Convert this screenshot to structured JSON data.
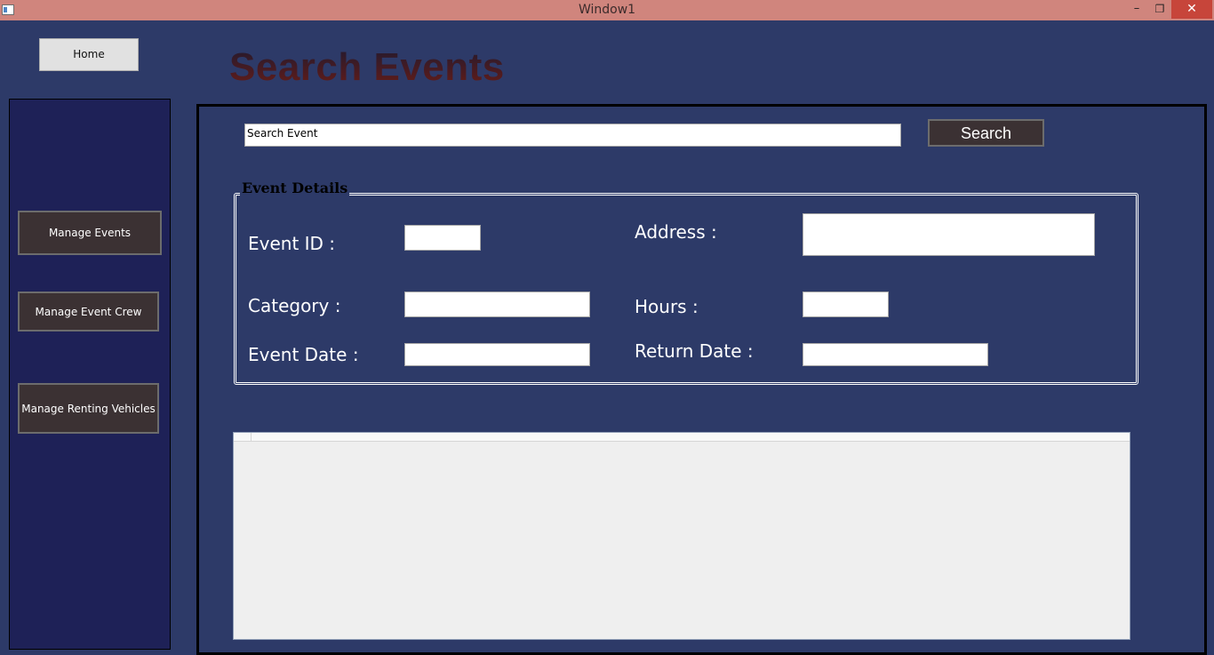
{
  "window": {
    "title": "Window1",
    "minimize": "–",
    "maximize": "❐",
    "close": "✕"
  },
  "header": {
    "home_label": "Home",
    "page_title": "Search Events"
  },
  "sidebar": {
    "items": [
      {
        "label": "Manage Events"
      },
      {
        "label": "Manage Event Crew"
      },
      {
        "label": "Manage Renting Vehicles"
      }
    ]
  },
  "search": {
    "value": "Search Event",
    "button_label": "Search"
  },
  "event_details": {
    "legend": "Event Details",
    "labels": {
      "event_id": "Event ID :",
      "category": "Category :",
      "event_date": "Event Date :",
      "address": "Address :",
      "hours": "Hours :",
      "return_date": "Return Date :"
    },
    "values": {
      "event_id": "",
      "category": "",
      "event_date": "",
      "address": "",
      "hours": "",
      "return_date": ""
    }
  },
  "colors": {
    "background": "#2d3a68",
    "sidebar": "#1e2157",
    "button": "#3b3133",
    "titlebar": "#d0857d"
  }
}
